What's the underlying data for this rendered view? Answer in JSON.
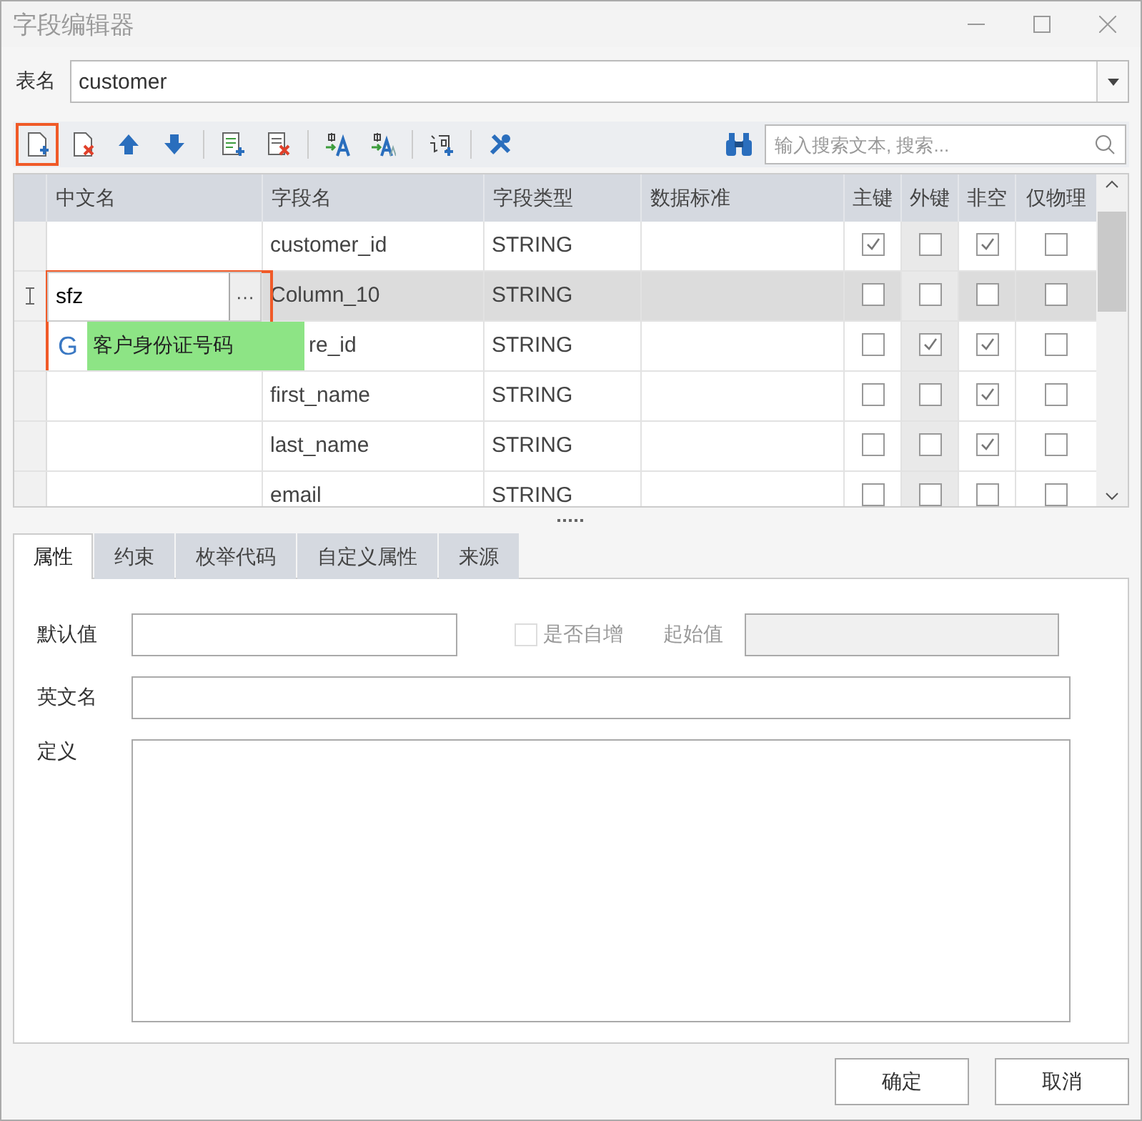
{
  "window": {
    "title": "字段编辑器"
  },
  "table_name": {
    "label": "表名",
    "value": "customer"
  },
  "toolbar": {
    "buttons": [
      {
        "kind": "new-row",
        "highlighted": true
      },
      {
        "kind": "delete-row",
        "highlighted": false
      },
      {
        "kind": "move-up",
        "highlighted": false
      },
      {
        "kind": "move-down",
        "highlighted": false
      },
      {
        "kind": "separator"
      },
      {
        "kind": "add-column",
        "highlighted": false
      },
      {
        "kind": "delete-column",
        "highlighted": false
      },
      {
        "kind": "separator"
      },
      {
        "kind": "translate",
        "highlighted": false
      },
      {
        "kind": "translate-all",
        "highlighted": false
      },
      {
        "kind": "separator"
      },
      {
        "kind": "add-word",
        "highlighted": false
      },
      {
        "kind": "separator"
      },
      {
        "kind": "tools",
        "highlighted": false
      }
    ],
    "search": {
      "placeholder": "输入搜索文本, 搜索..."
    }
  },
  "grid": {
    "columns": [
      {
        "label": "中文名",
        "kind": "text",
        "shaded": false
      },
      {
        "label": "字段名",
        "kind": "text",
        "shaded": false
      },
      {
        "label": "字段类型",
        "kind": "text",
        "shaded": false
      },
      {
        "label": "数据标准",
        "kind": "text",
        "shaded": false
      },
      {
        "label": "主键",
        "kind": "check",
        "shaded": false
      },
      {
        "label": "外键",
        "kind": "check",
        "shaded": true
      },
      {
        "label": "非空",
        "kind": "check",
        "shaded": false
      },
      {
        "label": "仅物理",
        "kind": "check",
        "shaded": false
      }
    ],
    "rows": [
      {
        "selected": false,
        "cells": [
          "",
          "customer_id",
          "STRING",
          ""
        ],
        "checks": [
          true,
          false,
          true,
          false
        ]
      },
      {
        "selected": true,
        "cells": [
          "",
          "Column_10",
          "STRING",
          ""
        ],
        "checks": [
          false,
          false,
          false,
          false
        ],
        "editor": {
          "value": "sfz",
          "button": "···",
          "badge": "G",
          "suggestion": "客户身份证号码",
          "highlighted": true
        }
      },
      {
        "selected": false,
        "cells": [
          "",
          "re_id",
          "STRING",
          ""
        ],
        "checks": [
          false,
          true,
          true,
          false
        ]
      },
      {
        "selected": false,
        "cells": [
          "",
          "first_name",
          "STRING",
          ""
        ],
        "checks": [
          false,
          false,
          true,
          false
        ]
      },
      {
        "selected": false,
        "cells": [
          "",
          "last_name",
          "STRING",
          ""
        ],
        "checks": [
          false,
          false,
          true,
          false
        ]
      },
      {
        "selected": false,
        "cells": [
          "",
          "email",
          "STRING",
          ""
        ],
        "checks": [
          false,
          false,
          false,
          false
        ]
      }
    ]
  },
  "tabs": [
    {
      "label": "属性",
      "selected": true
    },
    {
      "label": "约束",
      "selected": false
    },
    {
      "label": "枚举代码",
      "selected": false
    },
    {
      "label": "自定义属性",
      "selected": false
    },
    {
      "label": "来源",
      "selected": false
    }
  ],
  "form": {
    "default_label": "默认值",
    "auto_increment": {
      "label": "是否自增",
      "checked": false,
      "disabled": true
    },
    "start_label": "起始值",
    "english_label": "英文名",
    "definition_label": "定义"
  },
  "buttons": [
    "确定",
    "取消"
  ]
}
